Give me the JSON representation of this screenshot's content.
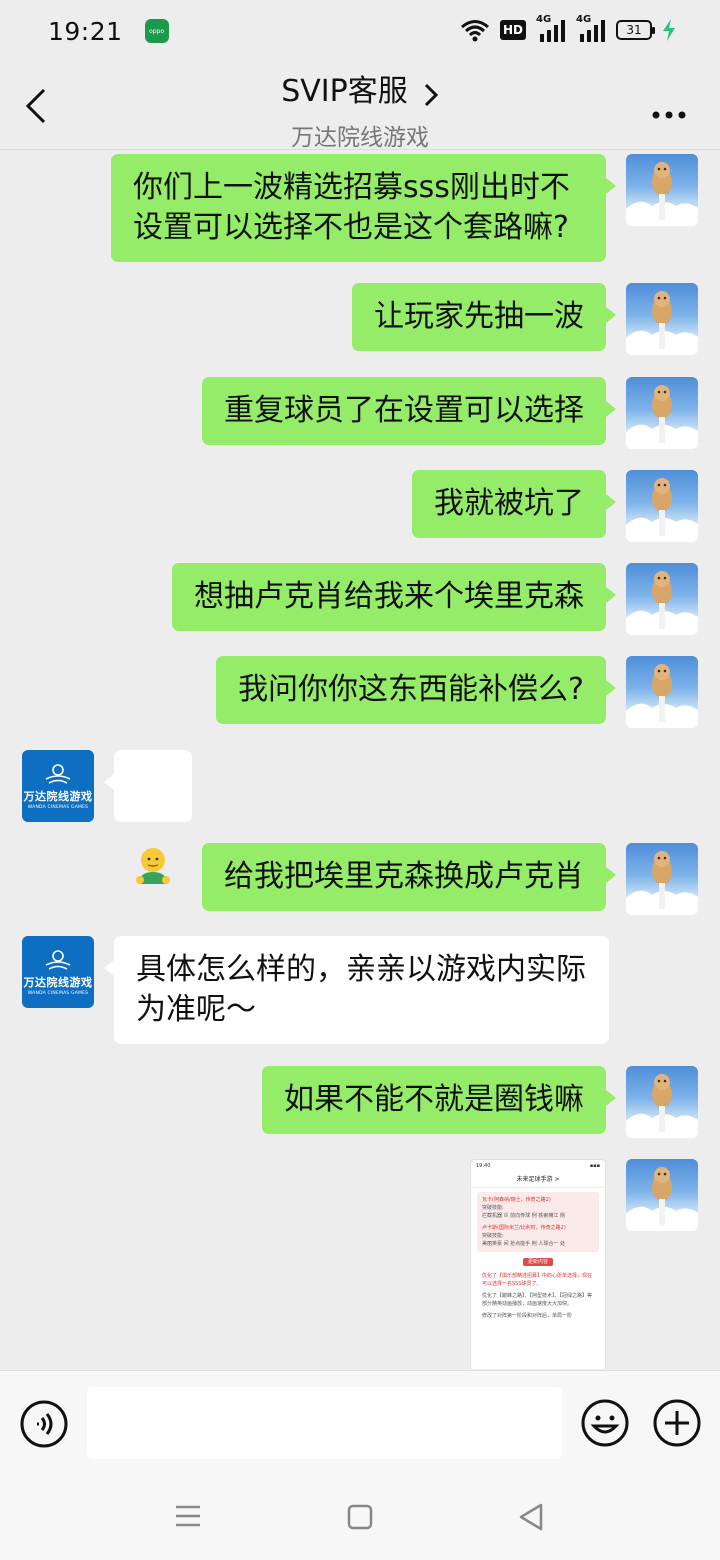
{
  "status_bar": {
    "time": "19:21",
    "app_badge": "oppo",
    "hd_label": "HD",
    "net1_label": "4G",
    "net2_label": "4G",
    "battery": "31"
  },
  "header": {
    "title": "SVIP客服",
    "subtitle": "万达院线游戏"
  },
  "cs_avatar": {
    "brand_cn": "万达院线游戏",
    "brand_en": "WANDA CINEMAS GAMES"
  },
  "messages": [
    {
      "sender": "user",
      "text": "你们上一波精选招募sss刚出时不\n设置可以选择不也是这个套路嘛?"
    },
    {
      "sender": "user",
      "text": "让玩家先抽一波"
    },
    {
      "sender": "user",
      "text": "重复球员了在设置可以选择"
    },
    {
      "sender": "user",
      "text": "我就被坑了"
    },
    {
      "sender": "user",
      "text": "想抽卢克肖给我来个埃里克森"
    },
    {
      "sender": "user",
      "text": "我问你你这东西能补偿么?"
    },
    {
      "sender": "cs",
      "text": "",
      "emoji": "🫡"
    },
    {
      "sender": "user",
      "text": "给我把埃里克森换成卢克肖"
    },
    {
      "sender": "cs",
      "text": "具体怎么样的，亲亲以游戏内实际\n为准呢～"
    },
    {
      "sender": "user",
      "text": "如果不能不就是圈钱嘛"
    },
    {
      "sender": "user",
      "type": "image"
    }
  ],
  "screenshot": {
    "time": "19:40",
    "title": "未来足球手游 >",
    "line1": "瓦卡(阿森纳/瑞士，传奇之路2)",
    "line2": "突破技能:",
    "line3": "拦截机器 炎  前向传球 例    铁索横江 侧",
    "line4": "卢卡斯(国际米兰/比利时，传奇之路2)",
    "line5": "突破技能:",
    "line6": "美丽英豪 间  抢点能手 荆    人球合一 处",
    "tag": "更新内容",
    "para1": "优化了【俱乐部精选招募】中的心愿单选择，现在可以选择一名SSS球员了。",
    "para2": "优化了【巅峰之路】、【阿型技术】、【冠绿之路】等部分精英动画播放，动画速度大大加快。",
    "para3": "修改了对阵第一阶段和对阵后，单局一阶"
  },
  "input": {
    "placeholder": ""
  }
}
